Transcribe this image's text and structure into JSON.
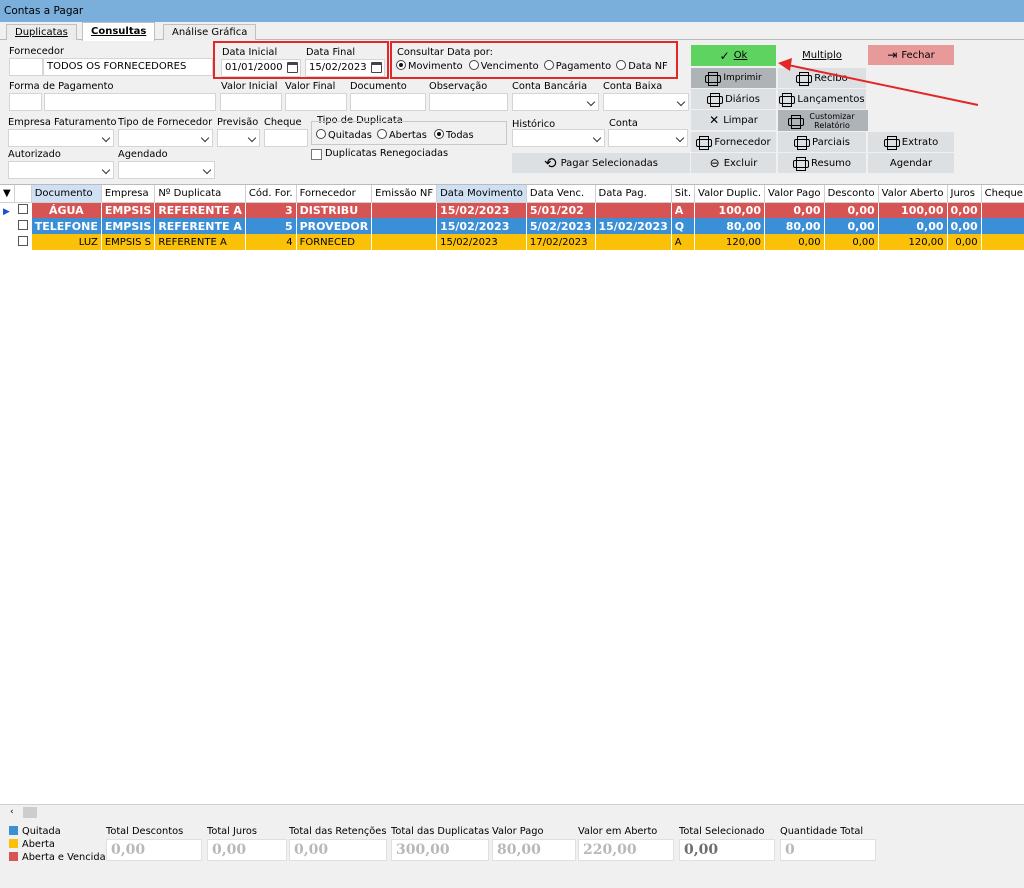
{
  "window": {
    "title": "Contas a Pagar"
  },
  "tabs": [
    "Duplicatas",
    "Consultas",
    "Análise Gráfica"
  ],
  "filters": {
    "fornecedor_label": "Fornecedor",
    "fornecedor_value": "TODOS OS FORNECEDORES",
    "data_inicial_label": "Data Inicial",
    "data_inicial": "01/01/2000",
    "data_final_label": "Data Final",
    "data_final": "15/02/2023",
    "consultar_label": "Consultar Data por:",
    "consultar_options": [
      "Movimento",
      "Vencimento",
      "Pagamento",
      "Data NF"
    ],
    "forma_pagamento": "Forma de Pagamento",
    "valor_inicial": "Valor Inicial",
    "valor_final": "Valor Final",
    "documento": "Documento",
    "observacao": "Observação",
    "conta_bancaria": "Conta Bancária",
    "conta_baixa": "Conta Baixa",
    "empresa_faturamento": "Empresa Faturamento",
    "tipo_fornecedor": "Tipo de Fornecedor",
    "previsao": "Previsão",
    "cheque": "Cheque",
    "tipo_duplicata": "Tipo de Duplicata",
    "tipo_options": [
      "Quitadas",
      "Abertas",
      "Todas"
    ],
    "historico": "Histórico",
    "conta": "Conta",
    "autorizado": "Autorizado",
    "agendado": "Agendado",
    "renegociadas": "Duplicatas Renegociadas"
  },
  "buttons": {
    "ok": "Ok",
    "multiplo": "Multiplo",
    "fechar": "Fechar",
    "imprimir": "Imprimir",
    "recibo": "Recibo",
    "diarios": "Diários",
    "lancamentos": "Lançamentos",
    "limpar": "Limpar",
    "customizar": "Customizar Relatório",
    "fornecedor": "Fornecedor",
    "parciais": "Parciais",
    "extrato": "Extrato",
    "pagar": "Pagar Selecionadas",
    "excluir": "Excluir",
    "resumo": "Resumo",
    "agendar": "Agendar"
  },
  "table": {
    "columns": [
      "Documento",
      "Empresa",
      "Nº Duplicata",
      "Cód. For.",
      "Fornecedor",
      "Emissão NF",
      "Data Movimento",
      "Data Venc.",
      "Data Pag.",
      "Sit.",
      "Valor Duplic.",
      "Valor Pago",
      "Desconto",
      "Valor Aberto",
      "Juros",
      "Cheque"
    ],
    "rows": [
      {
        "status": "red",
        "cells": [
          "ÁGUA",
          "EMPSIS",
          "REFERENTE A",
          "3",
          "DISTRIBU",
          "",
          "15/02/2023",
          "5/01/202",
          "",
          "A",
          "100,00",
          "0,00",
          "0,00",
          "100,00",
          "0,00",
          ""
        ]
      },
      {
        "status": "blue",
        "cells": [
          "TELEFONE",
          "EMPSIS",
          "REFERENTE A",
          "5",
          "PROVEDOR",
          "",
          "15/02/2023",
          "5/02/2023",
          "15/02/2023",
          "Q",
          "80,00",
          "80,00",
          "0,00",
          "0,00",
          "0,00",
          ""
        ]
      },
      {
        "status": "yellow",
        "cells": [
          "LUZ",
          "EMPSIS S",
          "REFERENTE A",
          "4",
          "FORNECED",
          "",
          "15/02/2023",
          "17/02/2023",
          "",
          "A",
          "120,00",
          "0,00",
          "0,00",
          "120,00",
          "0,00",
          ""
        ]
      }
    ]
  },
  "legend": [
    {
      "label": "Quitada",
      "color": "#3a8fd6"
    },
    {
      "label": "Aberta",
      "color": "#fbc108"
    },
    {
      "label": "Aberta e Vencida",
      "color": "#d75454"
    }
  ],
  "totals": [
    {
      "label": "Total Descontos",
      "value": "0,00"
    },
    {
      "label": "Total Juros",
      "value": "0,00"
    },
    {
      "label": "Total das Retenções",
      "value": "0,00"
    },
    {
      "label": "Total das Duplicatas",
      "value": "300,00"
    },
    {
      "label": "Valor Pago",
      "value": "80,00"
    },
    {
      "label": "Valor em Aberto",
      "value": "220,00"
    },
    {
      "label": "Total Selecionado",
      "value": "0,00"
    },
    {
      "label": "Quantidade Total",
      "value": "0"
    }
  ]
}
